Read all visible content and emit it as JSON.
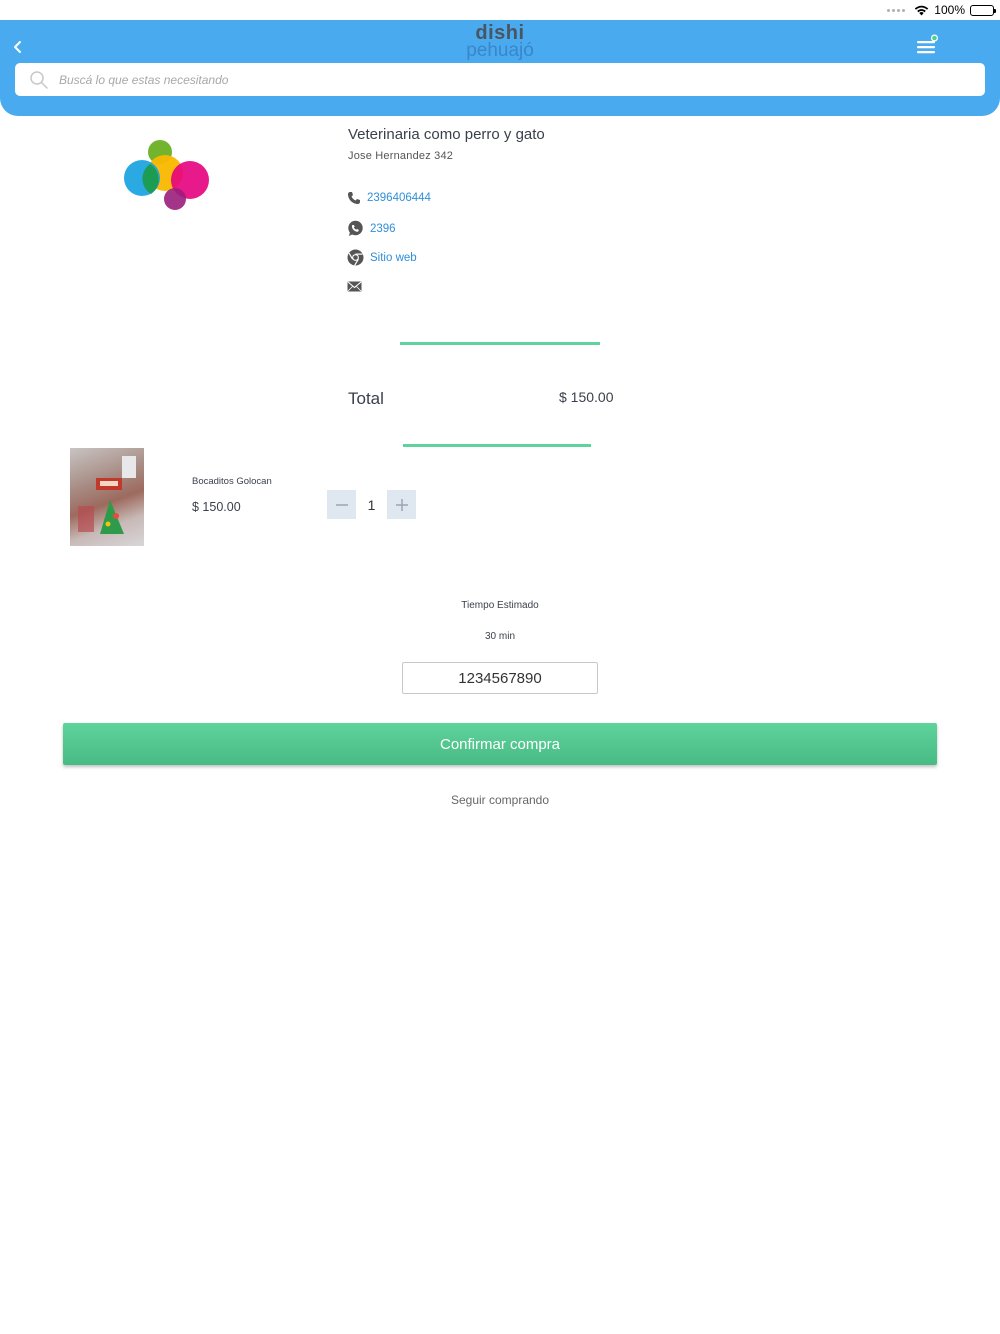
{
  "status_bar": {
    "battery": "100%"
  },
  "header": {
    "logo_top": "dishi",
    "logo_bottom": "pehuajó",
    "search_placeholder": "Buscá lo que estas necesitando"
  },
  "store": {
    "name": "Veterinaria como perro y gato",
    "address": "Jose Hernandez 342",
    "phone": "2396406444",
    "whatsapp": "2396",
    "website_label": "Sitio web"
  },
  "cart": {
    "total_label": "Total",
    "total_value": "$ 150.00",
    "items": [
      {
        "name": "Bocaditos Golocan",
        "price": "$ 150.00",
        "quantity": "1"
      }
    ]
  },
  "checkout": {
    "eta_label": "Tiempo Estimado",
    "eta_value": "30 min",
    "phone_value": "1234567890",
    "confirm_label": "Confirmar compra",
    "continue_label": "Seguir comprando"
  },
  "colors": {
    "header_blue": "#4aaaf0",
    "accent_green": "#5ed39b",
    "link_blue": "#2f8fd8"
  }
}
